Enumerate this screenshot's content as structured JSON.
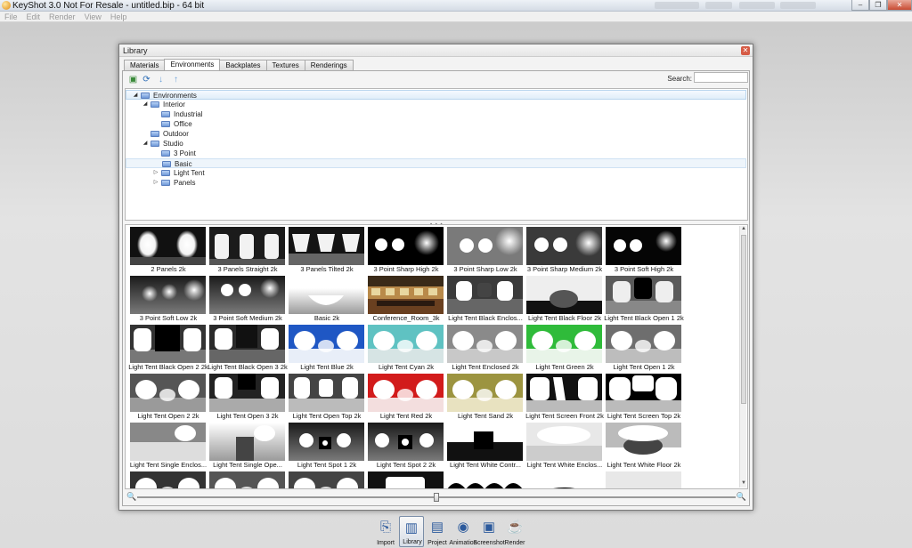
{
  "window": {
    "title": "KeyShot 3.0 Not For Resale  -  untitled.bip  -  64 bit",
    "controls": [
      "–",
      "❐",
      "✕"
    ]
  },
  "menu": [
    "File",
    "Edit",
    "Render",
    "View",
    "Help"
  ],
  "library": {
    "title": "Library",
    "tabs": [
      {
        "label": "Materials"
      },
      {
        "label": "Environments"
      },
      {
        "label": "Backplates"
      },
      {
        "label": "Textures"
      },
      {
        "label": "Renderings"
      }
    ],
    "active_tab": "Environments",
    "search_label": "Search:",
    "search_value": "",
    "tree": [
      {
        "label": "Environments",
        "level": 0,
        "arrow": "◢"
      },
      {
        "label": "Interior",
        "level": 1,
        "arrow": "◢"
      },
      {
        "label": "Industrial",
        "level": 2,
        "arrow": ""
      },
      {
        "label": "Office",
        "level": 2,
        "arrow": ""
      },
      {
        "label": "Outdoor",
        "level": 1,
        "arrow": ""
      },
      {
        "label": "Studio",
        "level": 1,
        "arrow": "◢"
      },
      {
        "label": "3 Point",
        "level": 2,
        "arrow": ""
      },
      {
        "label": "Basic",
        "level": 2,
        "arrow": ""
      },
      {
        "label": "Light Tent",
        "level": 2,
        "arrow": "▷"
      },
      {
        "label": "Panels",
        "level": 2,
        "arrow": "▷"
      }
    ],
    "selected_tree_item": "Environments",
    "highlighted_tree_item": "Basic",
    "thumbnails": [
      {
        "label": "2 Panels 2k",
        "style": "panels2"
      },
      {
        "label": "3 Panels Straight 2k",
        "style": "panels3s"
      },
      {
        "label": "3 Panels Tilted 2k",
        "style": "panels3t"
      },
      {
        "label": "3 Point Sharp High 2k",
        "style": "dots3dark"
      },
      {
        "label": "3 Point Sharp Low 2k",
        "style": "dots3gray"
      },
      {
        "label": "3 Point Sharp Medium 2k",
        "style": "dots3mid"
      },
      {
        "label": "3 Point Soft High 2k",
        "style": "dots3soft"
      },
      {
        "label": "3 Point Soft Low 2k",
        "style": "softlow"
      },
      {
        "label": "3 Point Soft Medium 2k",
        "style": "softmed"
      },
      {
        "label": "Basic 2k",
        "style": "basic"
      },
      {
        "label": "Conference_Room_3k",
        "style": "conference"
      },
      {
        "label": "Light Tent Black Enclos...",
        "style": "tentblackenc"
      },
      {
        "label": "Light Tent Black Floor 2k",
        "style": "tentblackfloor"
      },
      {
        "label": "Light Tent Black Open 1 2k",
        "style": "tentblackopen"
      },
      {
        "label": "Light Tent Black Open 2 2k",
        "style": "tentblackopen2"
      },
      {
        "label": "Light Tent Black Open 3 2k",
        "style": "tentblackopen3"
      },
      {
        "label": "Light Tent Blue 2k",
        "style": "tentblue"
      },
      {
        "label": "Light Tent Cyan 2k",
        "style": "tentcyan"
      },
      {
        "label": "Light Tent Enclosed 2k",
        "style": "tentenclosed"
      },
      {
        "label": "Light Tent Green 2k",
        "style": "tentgreen"
      },
      {
        "label": "Light Tent Open 1 2k",
        "style": "tentopen1"
      },
      {
        "label": "Light Tent Open 2 2k",
        "style": "tentopen2"
      },
      {
        "label": "Light Tent Open 3 2k",
        "style": "tentopen3"
      },
      {
        "label": "Light Tent Open Top 2k",
        "style": "tentopentop"
      },
      {
        "label": "Light Tent Red 2k",
        "style": "tentred"
      },
      {
        "label": "Light Tent Sand 2k",
        "style": "tentsand"
      },
      {
        "label": "Light Tent Screen Front 2k",
        "style": "tentscreenfront"
      },
      {
        "label": "Light Tent Screen Top 2k",
        "style": "tentscreentop"
      },
      {
        "label": "Light Tent Single Enclos...",
        "style": "singleenc"
      },
      {
        "label": "Light Tent Single Ope...",
        "style": "singleopen"
      },
      {
        "label": "Light Tent Spot 1 2k",
        "style": "spot1"
      },
      {
        "label": "Light Tent Spot 2 2k",
        "style": "spot2"
      },
      {
        "label": "Light Tent White Contr...",
        "style": "whitecontr"
      },
      {
        "label": "Light Tent White Enclos...",
        "style": "whiteenc"
      },
      {
        "label": "Light Tent White Floor 2k",
        "style": "whitefloor"
      },
      {
        "label": "",
        "style": "row6a"
      },
      {
        "label": "",
        "style": "row6b"
      },
      {
        "label": "",
        "style": "row6c"
      },
      {
        "label": "",
        "style": "row6d"
      },
      {
        "label": "",
        "style": "row6e"
      },
      {
        "label": "",
        "style": "row6f"
      },
      {
        "label": "",
        "style": "row6g"
      }
    ],
    "zoom_level": 0.5
  },
  "dock": [
    {
      "label": "Import",
      "icon": "import-icon",
      "glyph": "⎘"
    },
    {
      "label": "Library",
      "icon": "library-icon",
      "glyph": "▥",
      "active": true
    },
    {
      "label": "Project",
      "icon": "project-icon",
      "glyph": "▤"
    },
    {
      "label": "Animation",
      "icon": "animation-icon",
      "glyph": "◉"
    },
    {
      "label": "Screenshot",
      "icon": "screenshot-icon",
      "glyph": "▣"
    },
    {
      "label": "Render",
      "icon": "render-icon",
      "glyph": "☕"
    }
  ],
  "colors": {
    "accent": "#2c5a9c",
    "selection": "#e1eef9",
    "close": "#c84b32"
  }
}
